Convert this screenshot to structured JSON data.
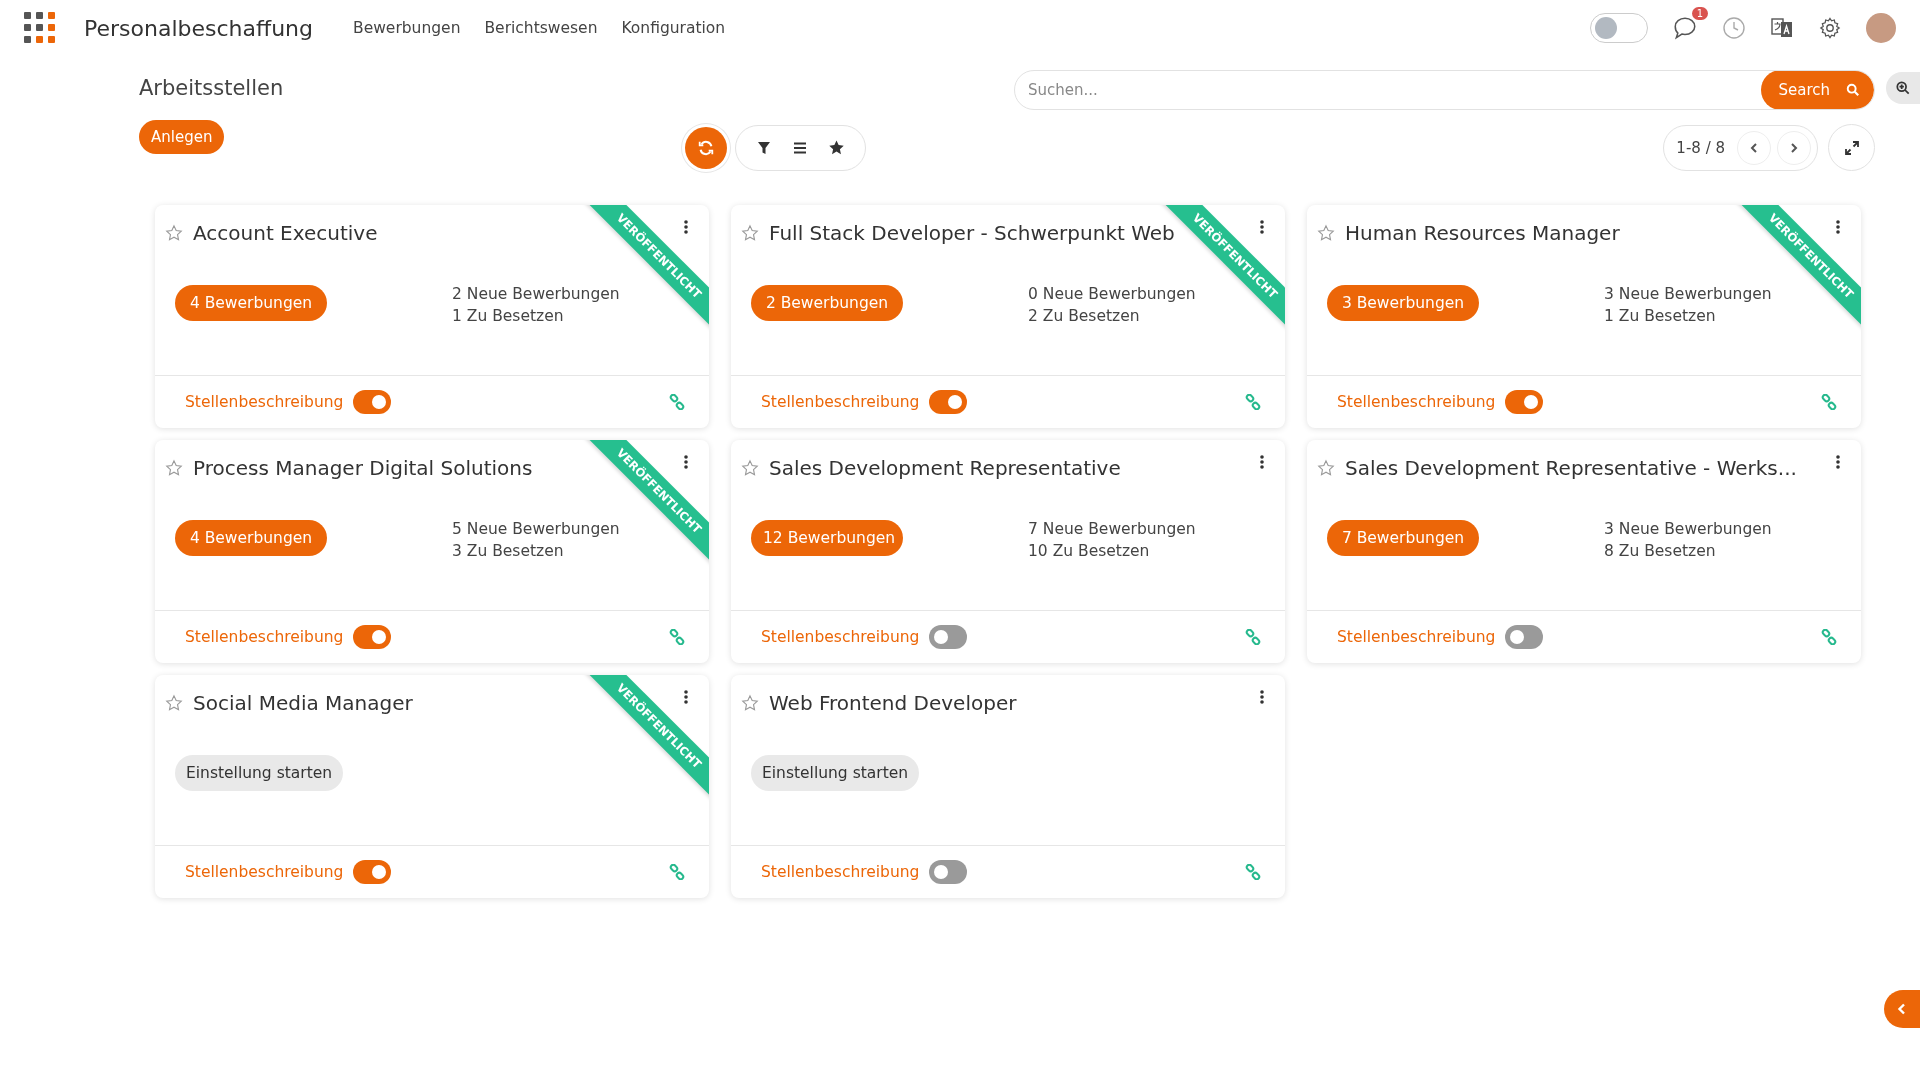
{
  "app": {
    "title": "Personalbeschaffung",
    "menu": [
      {
        "label": "Bewerbungen"
      },
      {
        "label": "Berichtswesen"
      },
      {
        "label": "Konfiguration"
      }
    ]
  },
  "header": {
    "mode_toggle_on": false,
    "notification_count": "1"
  },
  "page": {
    "title": "Arbeitsstellen",
    "create_button": "Anlegen"
  },
  "search": {
    "placeholder": "Suchen...",
    "button": "Search"
  },
  "pager": {
    "range": "1-8 / 8"
  },
  "jobs": [
    {
      "title": "Account Executive",
      "favorite": false,
      "ribbon": "VERÖFFENTLICHT",
      "kind": "applications",
      "action": "4 Bewerbungen",
      "new": "2 Neue Bewerbungen",
      "open": "1 Zu Besetzen",
      "description_label": "Stellenbeschreibung",
      "description_on": true
    },
    {
      "title": "Full Stack Developer - Schwerpunkt Web",
      "favorite": false,
      "ribbon": "VERÖFFENTLICHT",
      "kind": "applications",
      "action": "2 Bewerbungen",
      "new": "0 Neue Bewerbungen",
      "open": "2 Zu Besetzen",
      "description_label": "Stellenbeschreibung",
      "description_on": true
    },
    {
      "title": "Human Resources Manager",
      "favorite": false,
      "ribbon": "VERÖFFENTLICHT",
      "kind": "applications",
      "action": "3 Bewerbungen",
      "new": "3 Neue Bewerbungen",
      "open": "1 Zu Besetzen",
      "description_label": "Stellenbeschreibung",
      "description_on": true
    },
    {
      "title": "Process Manager Digital Solutions",
      "favorite": false,
      "ribbon": "VERÖFFENTLICHT",
      "kind": "applications",
      "action": "4 Bewerbungen",
      "new": "5 Neue Bewerbungen",
      "open": "3 Zu Besetzen",
      "description_label": "Stellenbeschreibung",
      "description_on": true
    },
    {
      "title": "Sales Development Representative",
      "favorite": false,
      "kind": "applications",
      "action": "12 Bewerbungen",
      "new": "7 Neue Bewerbungen",
      "open": "10 Zu Besetzen",
      "description_label": "Stellenbeschreibung",
      "description_on": false
    },
    {
      "title": "Sales Development Representative - Werks...",
      "favorite": false,
      "kind": "applications",
      "action": "7 Bewerbungen",
      "new": "3 Neue Bewerbungen",
      "open": "8 Zu Besetzen",
      "description_label": "Stellenbeschreibung",
      "description_on": false
    },
    {
      "title": "Social Media Manager",
      "favorite": false,
      "ribbon": "VERÖFFENTLICHT",
      "kind": "start",
      "action": "Einstellung starten",
      "description_label": "Stellenbeschreibung",
      "description_on": true
    },
    {
      "title": "Web Frontend Developer",
      "favorite": false,
      "kind": "start",
      "action": "Einstellung starten",
      "description_label": "Stellenbeschreibung",
      "description_on": false
    }
  ]
}
